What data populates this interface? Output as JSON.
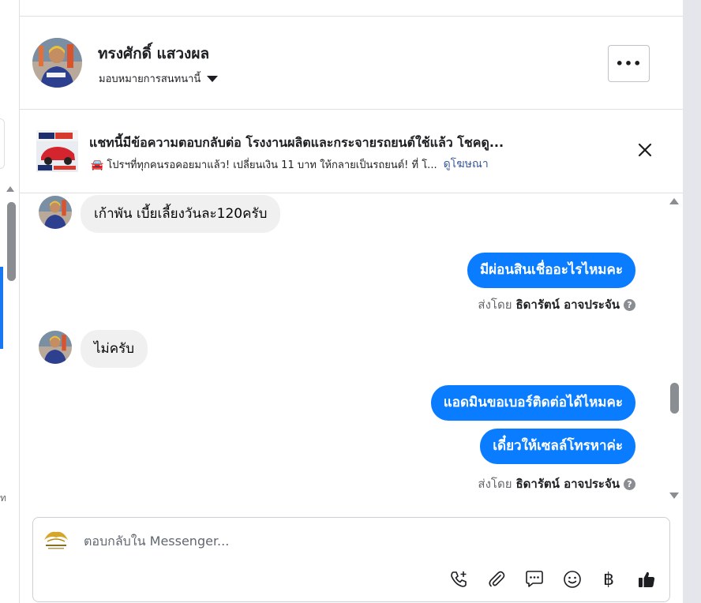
{
  "header": {
    "contact_name": "ทรงศักดิ์ แสวงผล",
    "assign_label": "มอบหมายการสนทนานี้",
    "more_label": "•••"
  },
  "ad": {
    "title": "แชทนี้มีข้อความตอบกลับต่อ โรงงานผลิตและกระจายรถยนต์ใช้แล้ว โชคดู...",
    "subtitle": "🚘 โปรฯที่ทุกคนรอคอยมาแล้ว! เปลี่ยนเงิน 11 บาท ให้กลายเป็นรถยนต์! ที่ โ...",
    "link": "ดูโฆษณา"
  },
  "messages": [
    {
      "from": "contact",
      "text": "เก้าพัน เบี้ยเลี้ยงวันละ120ครับ"
    },
    {
      "from": "page",
      "text": "มีผ่อนสินเชื่ออะไรไหมคะ"
    },
    {
      "from": "contact",
      "text": "ไม่ครับ"
    },
    {
      "from": "page",
      "text": "แอดมินขอเบอร์ติดต่อได้ไหมคะ"
    },
    {
      "from": "page",
      "text": "เดี๋ยวให้เซลล์โทรหาค่ะ"
    }
  ],
  "sent_by": {
    "prefix": "ส่งโดย",
    "name": "ธิดารัตน์ อาจประจัน",
    "info": "?"
  },
  "composer": {
    "placeholder": "ตอบกลับใน Messenger...",
    "tools": [
      "phone-plus-icon",
      "paperclip-icon",
      "saved-reply-icon",
      "emoji-icon",
      "baht-icon",
      "thumbs-up-icon"
    ],
    "baht_symbol": "฿"
  },
  "left_strip": {
    "char": "ท"
  },
  "colors": {
    "outgoing_bubble": "#0a7cff",
    "incoming_bubble": "#f0f0f0",
    "link": "#385898"
  }
}
